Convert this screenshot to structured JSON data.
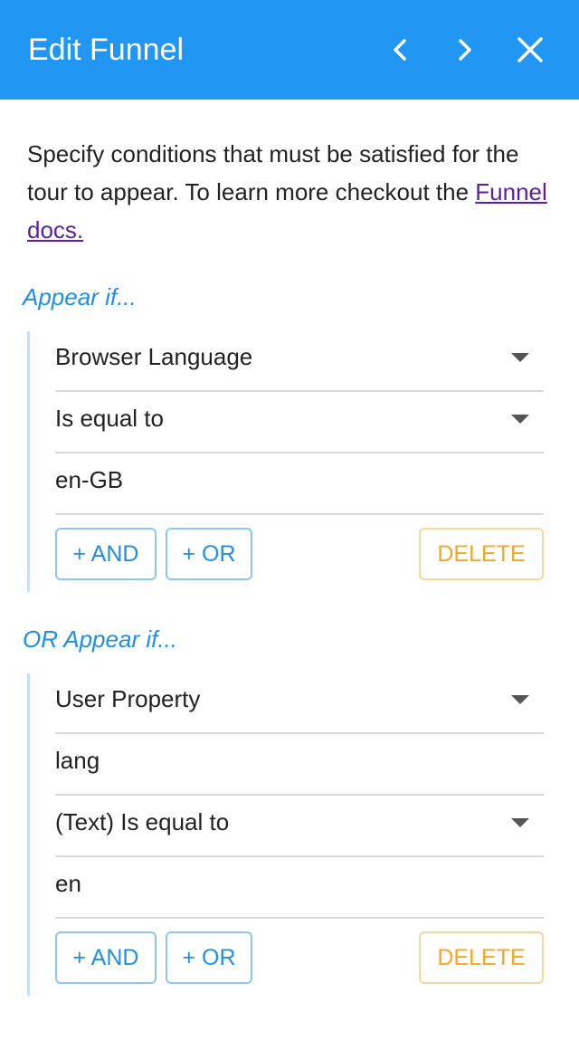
{
  "header": {
    "title": "Edit Funnel",
    "prev_icon": "chevron-left-icon",
    "next_icon": "chevron-right-icon",
    "close_icon": "close-icon",
    "background_color": "#2196f3"
  },
  "intro": {
    "text": "Specify conditions that must be satisfied for the tour to appear. To learn more checkout the ",
    "link_text": "Funnel docs."
  },
  "groups": [
    {
      "title": "Appear if...",
      "fields": [
        {
          "value": "Browser Language",
          "type": "select"
        },
        {
          "value": "Is equal to",
          "type": "select"
        },
        {
          "value": "en-GB",
          "type": "text"
        }
      ],
      "and_label": "+ AND",
      "or_label": "+ OR",
      "delete_label": "DELETE"
    },
    {
      "title": "OR Appear if...",
      "fields": [
        {
          "value": "User Property",
          "type": "select"
        },
        {
          "value": "lang",
          "type": "text"
        },
        {
          "value": "(Text) Is equal to",
          "type": "select"
        },
        {
          "value": "en",
          "type": "text"
        }
      ],
      "and_label": "+ AND",
      "or_label": "+ OR",
      "delete_label": "DELETE"
    }
  ],
  "colors": {
    "accent_blue": "#1f8fe8",
    "delete_orange": "#f5a623",
    "link_purple": "#5b1fa6"
  }
}
